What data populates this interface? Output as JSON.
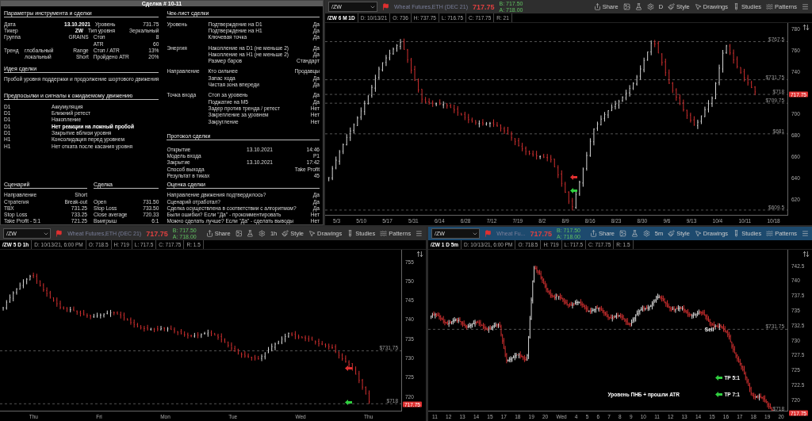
{
  "journal": {
    "title": "Сделка # 10-11",
    "params": {
      "title": "Параметры инструмента и сделки",
      "rows": [
        {
          "label": "Дата",
          "value": "13.10.2021",
          "bold": true,
          "label2": "Уровень",
          "value2": "731.75"
        },
        {
          "label": "Тикер",
          "value": "ZW",
          "bold": true,
          "label2": "Тип уровня",
          "value2": "Зеркальный"
        },
        {
          "label": "Группа",
          "value": "GRAINS",
          "bold": false,
          "label2": "Стоп",
          "value2": "8"
        },
        {
          "label2": "ATR",
          "value2": "60"
        },
        {
          "label": "Тренд",
          "sub": "глобальный",
          "value": "Range",
          "bold": false,
          "label2": "Стоп / ATR",
          "value2": "13%"
        },
        {
          "sub": "локальный",
          "value": "Short",
          "bold": false,
          "label2": "Пройдено ATR",
          "value2": "20%"
        }
      ]
    },
    "idea": {
      "title": "Идея сделки",
      "text": "Пробой уровня поддержки и продолжение шортового движения"
    },
    "signals": {
      "title": "Предпосылки и сигналы к ожидаемому движению",
      "rows": [
        {
          "tf": "D1",
          "text": "Аккумуляция",
          "highlight": false
        },
        {
          "tf": "D1",
          "text": "Ближний ретест",
          "highlight": false
        },
        {
          "tf": "D1",
          "text": "Накопление",
          "highlight": false
        },
        {
          "tf": "D1",
          "text": "Нет реакции на ложный пробой",
          "highlight": true
        },
        {
          "tf": "D1",
          "text": "Закрытие вблизи уровня",
          "highlight": false
        },
        {
          "tf": "H1",
          "text": "Консолидация перед уровнем",
          "highlight": false
        },
        {
          "tf": "H1",
          "text": "Нет отката после касания уровня",
          "highlight": false
        }
      ]
    },
    "scenario": {
      "title": "Сценарий",
      "rows": [
        {
          "label": "Направление",
          "value": "Short"
        },
        {
          "label": "Стратегия",
          "value": "Break-out"
        },
        {
          "label": "ТВХ",
          "value": "731.25"
        },
        {
          "label": "Stop Loss",
          "value": "733.25"
        },
        {
          "label": "Take Profit - 5:1",
          "value": "721.25"
        }
      ]
    },
    "trade": {
      "title": "Сделка",
      "rows": [
        {
          "label": "Open",
          "value": "731.50"
        },
        {
          "label": "Stop Loss",
          "value": "733.50"
        },
        {
          "label": "Close average",
          "value": "720.33"
        },
        {
          "label": "Выигрыш",
          "value": "6:1"
        }
      ]
    },
    "checklist": {
      "title": "Чек-лист сделки",
      "groups": [
        {
          "name": "Уровень",
          "items": [
            {
              "text": "Подтверждение на D1",
              "answer": "Да"
            },
            {
              "text": "Подтверждение на H1",
              "answer": "Да"
            },
            {
              "text": "Ключевая точка",
              "answer": "Да"
            }
          ]
        },
        {
          "name": "Энергия",
          "items": [
            {
              "text": "Накопление на D1 (не меньше 2)",
              "answer": "Да"
            },
            {
              "text": "Накопление на H1 (не меньше 2)",
              "answer": "Да"
            },
            {
              "text": "Размер баров",
              "answer": "Стандарт"
            }
          ]
        },
        {
          "name": "Направление",
          "items": [
            {
              "text": "Кто сильнее",
              "answer": "Продавцы"
            },
            {
              "text": "Запас хода",
              "answer": "Да"
            },
            {
              "text": "Чистая зона впереди",
              "answer": "Да"
            }
          ]
        },
        {
          "name": "Точка входа",
          "items": [
            {
              "text": "Стоп за уровень",
              "answer": "Да"
            },
            {
              "text": "Поджатие на M5",
              "answer": "Да"
            },
            {
              "text": "Задер против тренда / ретест",
              "answer": "Нет"
            },
            {
              "text": "Закрепление за уровнем",
              "answer": "Нет"
            },
            {
              "text": "Закругление",
              "answer": "Нет"
            }
          ]
        }
      ]
    },
    "protocol": {
      "title": "Протокол сделки",
      "rows": [
        {
          "label": "Открытие",
          "date": "13.10.2021",
          "value": "14:46"
        },
        {
          "label": "Модель входа",
          "value": "P1"
        },
        {
          "label": "Закрытие",
          "date": "13.10.2021",
          "value": "17:42"
        },
        {
          "label": "Способ выхода",
          "value": "Take Profit"
        },
        {
          "label": "Результат в тиках",
          "value": "45"
        }
      ]
    },
    "evaluation": {
      "title": "Оценка сделки",
      "rows": [
        {
          "question": "Направление движения подтвердилось?",
          "answer": "Да"
        },
        {
          "question": "Сценарий отработал?",
          "answer": "Да"
        },
        {
          "question": "Сделка осуществлена в соответствии с алгоритмом?",
          "answer": "Да"
        },
        {
          "question": "Были ошибки? Если \"Да\" - прокомментировать",
          "answer": "Нет"
        },
        {
          "question": "Можно сделать лучше? Если \"Да\" - сделать выводы",
          "answer": "Нет"
        }
      ]
    }
  },
  "charts": [
    {
      "active": false,
      "symbol": "/ZW",
      "description": "Wheat Futures,ETH (DEC 21)",
      "price": "717.75",
      "bid": "B: 717.50",
      "ask": "A: 718.00",
      "timeframe": "D",
      "toolbar": [
        "Share",
        "Style",
        "Drawings",
        "Studies",
        "Patterns"
      ],
      "info": [
        "/ZW 6 M 1D",
        "D: 10/13/21",
        "O: 736",
        "H: 737.75",
        "L: 716.75",
        "C: 717.75",
        "R: 21"
      ],
      "yticks": [
        "780",
        "760",
        "740",
        "700",
        "680",
        "660",
        "640",
        "620"
      ],
      "levels": [
        "$767.5",
        "$731.75",
        "$718",
        "$709.75",
        "$681",
        "$609.5"
      ],
      "last_price": "717.75",
      "dates": [
        "5/3",
        "5/10",
        "5/17",
        "5/31",
        "6/14",
        "6/28",
        "7/12",
        "7/19",
        "8/2",
        "8/9",
        "8/16",
        "8/23",
        "8/30",
        "9/6",
        "9/13",
        "10/4",
        "10/11",
        "10/18"
      ]
    },
    {
      "active": false,
      "symbol": "/ZW",
      "description": "Wheat Futures,ETH (DEC 21)",
      "price": "717.75",
      "bid": "B: 717.50",
      "ask": "A: 718.00",
      "timeframe": "1h",
      "toolbar": [
        "Share",
        "Style",
        "Drawings",
        "Studies",
        "Patterns"
      ],
      "info": [
        "/ZW 5 D 1h",
        "D: 10/13/21, 6:00 PM",
        "O: 718.5",
        "H: 719",
        "L: 717.5",
        "C: 717.75",
        "R: 1.5"
      ],
      "yticks": [
        "755",
        "750",
        "745",
        "740",
        "735",
        "730",
        "725",
        "720"
      ],
      "levels": [
        "$731.75",
        "$718"
      ],
      "last_price": "717.75",
      "dates": [
        "Thu",
        "Fri",
        "Mon",
        "Tue",
        "Wed",
        "Thu"
      ]
    },
    {
      "active": true,
      "symbol": "/ZW",
      "description": "Wheat Fu...",
      "price": "717.75",
      "bid": "B: 717.50",
      "ask": "A: 718.00",
      "timeframe": "5m",
      "toolbar": [
        "Share",
        "Style",
        "Drawings",
        "Studies",
        "Patterns"
      ],
      "info": [
        "/ZW 1 D 5m",
        "D: 10/13/21, 6:00 PM",
        "O: 718.5",
        "H: 719",
        "L: 717.5",
        "C: 717.75",
        "R: 1.5"
      ],
      "yticks": [
        "742.5",
        "740",
        "737.5",
        "735",
        "732.5",
        "730",
        "727.5",
        "725",
        "722.5",
        "720"
      ],
      "levels": [
        "$731.75",
        "$718"
      ],
      "last_price": "717.75",
      "annotations": [
        {
          "text": "Sell",
          "kind": "label"
        },
        {
          "text": "TP 5:1",
          "kind": "tp"
        },
        {
          "text": "TP 7:1",
          "kind": "tp"
        },
        {
          "text": "Уровень ПНБ + прошли ATR",
          "kind": "label"
        }
      ],
      "dates": [
        "11",
        "12",
        "13",
        "14",
        "15",
        "17",
        "18",
        "19",
        "20",
        "Wed",
        "4",
        "5",
        "6",
        "7",
        "8",
        "9",
        "10",
        "11",
        "12",
        "13",
        "14",
        "15",
        "16",
        "17",
        "18",
        "19",
        "20"
      ]
    }
  ]
}
